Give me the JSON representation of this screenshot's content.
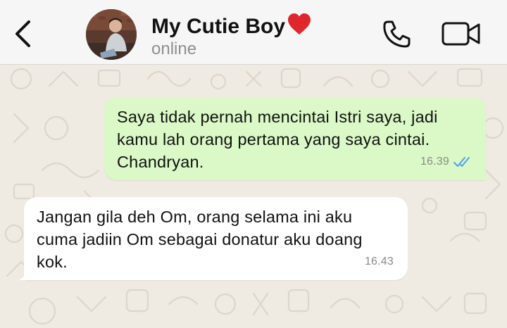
{
  "header": {
    "contact_name": "My Cutie Boy",
    "status": "online",
    "back_icon": "chevron-left-icon",
    "heart_icon": "red-heart-emoji",
    "call_icon": "phone-icon",
    "video_icon": "video-camera-icon"
  },
  "messages": [
    {
      "direction": "outgoing",
      "text": "Saya tidak pernah mencintai Istri saya, jadi\nkamu lah orang pertama yang saya cintai.\nChandryan.",
      "time": "16.39",
      "read_status": "read",
      "read_icon": "double-check-icon"
    },
    {
      "direction": "incoming",
      "text": "Jangan gila deh Om, orang selama ini aku\ncuma jadiin Om sebagai donatur aku doang\nkok.",
      "time": "16.43"
    }
  ],
  "colors": {
    "header_bg": "#f6f6f6",
    "chat_bg": "#efeae2",
    "outgoing_bubble": "#dbf8c7",
    "incoming_bubble": "#ffffff",
    "read_ticks": "#4fa3e8",
    "heart": "#e0262d"
  }
}
